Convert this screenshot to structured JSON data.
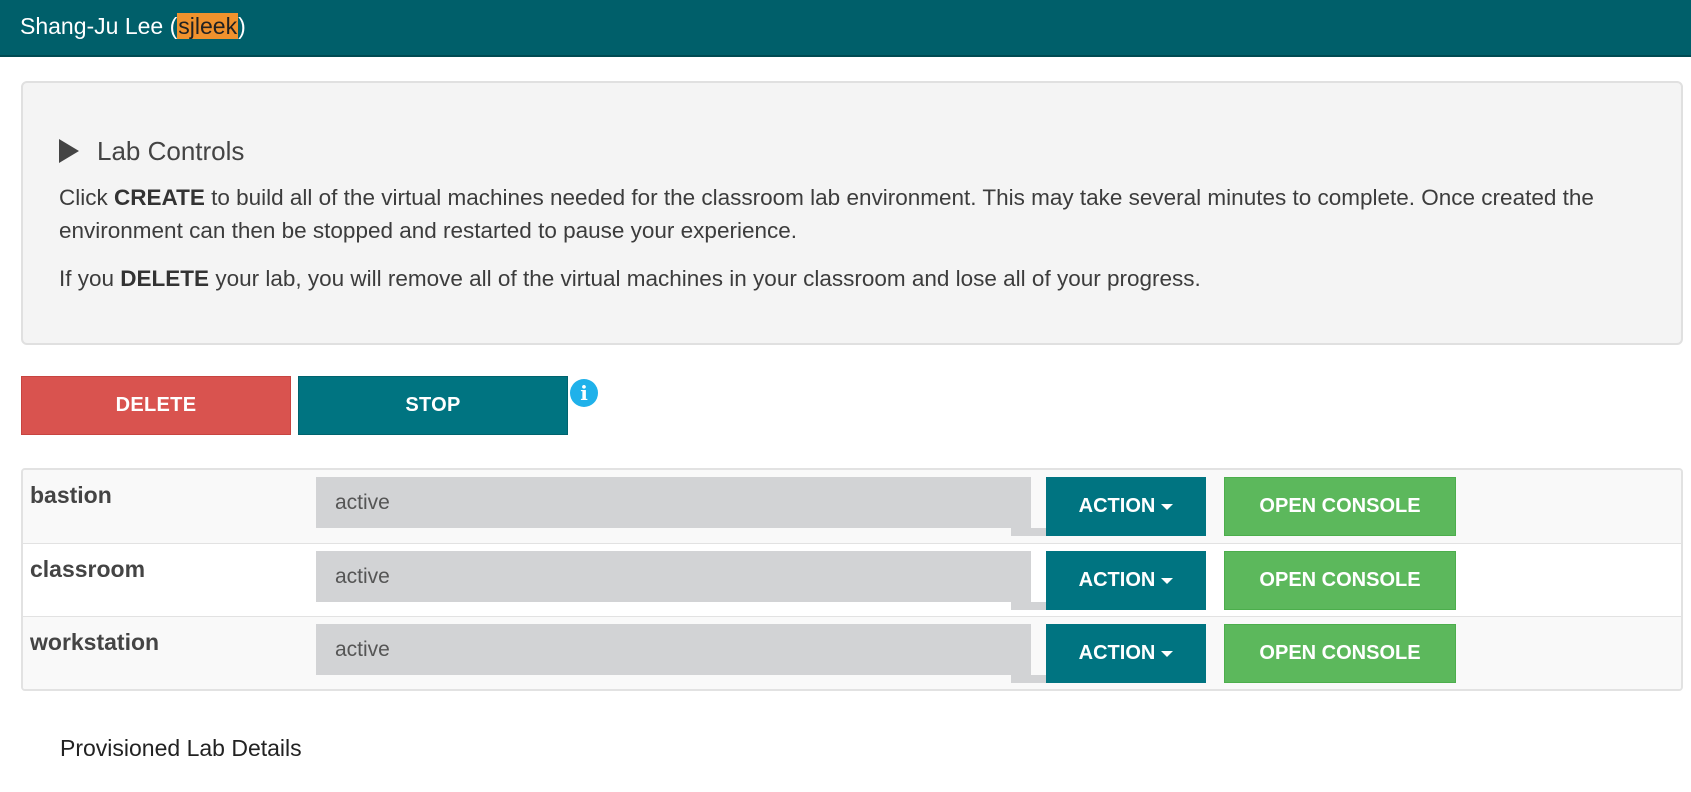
{
  "header": {
    "user_name_prefix": "Shang-Ju Lee (",
    "username": "sjleek",
    "user_name_suffix": ")"
  },
  "lab_controls": {
    "title": "Lab Controls",
    "paragraph1": {
      "pre": "Click ",
      "bold": "CREATE",
      "post": " to build all of the virtual machines needed for the classroom lab environment. This may take several minutes to complete. Once created the environment can then be stopped and restarted to pause your experience."
    },
    "paragraph2": {
      "pre": "If you ",
      "bold": "DELETE",
      "post": " your lab, you will remove all of the virtual machines in your classroom and lose all of your progress."
    }
  },
  "buttons": {
    "delete": "DELETE",
    "stop": "STOP",
    "info": "i"
  },
  "vms": [
    {
      "name": "bastion",
      "status": "active",
      "action": "ACTION",
      "console": "OPEN CONSOLE"
    },
    {
      "name": "classroom",
      "status": "active",
      "action": "ACTION",
      "console": "OPEN CONSOLE"
    },
    {
      "name": "workstation",
      "status": "active",
      "action": "ACTION",
      "console": "OPEN CONSOLE"
    }
  ],
  "details": {
    "title": "Provisioned Lab Details"
  },
  "colors": {
    "header_bg": "#005f6a",
    "username_highlight": "#f0922d",
    "delete": "#d9534f",
    "teal_button": "#007481",
    "console_green": "#5cb85c",
    "info_blue": "#1fb1ea"
  }
}
